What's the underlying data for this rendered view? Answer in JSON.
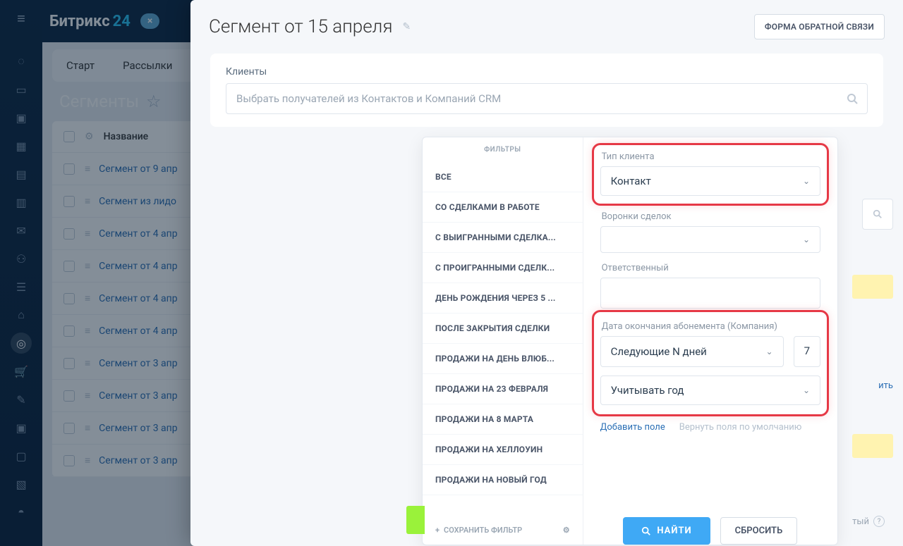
{
  "brand": {
    "part1": "Битрикс",
    "part2": "24",
    "close": "×"
  },
  "bg": {
    "tabs": [
      "Старт",
      "Рассылки"
    ],
    "title": "Сегменты",
    "list_header": "Название",
    "rows": [
      "Сегмент от 9 апр",
      "Сегмент из лидо",
      "Сегмент от 4 апр",
      "Сегмент от 4 апр",
      "Сегмент от 4 апр",
      "Сегмент от 4 апр",
      "Сегмент от 3 апр",
      "Сегмент от 3 апр",
      "Сегмент от 3 апр",
      "Сегмент от 3 апр"
    ]
  },
  "panel": {
    "title": "Сегмент от 15 апреля",
    "feedback_btn": "ФОРМА ОБРАТНОЙ СВЯЗИ",
    "clients_label": "Клиенты",
    "crm_placeholder": "Выбрать получателей из Контактов и Компаний CRM",
    "change": "ить",
    "private": "тый"
  },
  "filters": {
    "header": "ФИЛЬТРЫ",
    "items": [
      "ВСЕ",
      "СО СДЕЛКАМИ В РАБОТЕ",
      "С ВЫИГРАННЫМИ СДЕЛКА...",
      "С ПРОИГРАННЫМИ СДЕЛК...",
      "ДЕНЬ РОЖДЕНИЯ ЧЕРЕЗ 5 ...",
      "ПОСЛЕ ЗАКРЫТИЯ СДЕЛКИ",
      "ПРОДАЖИ НА ДЕНЬ ВЛЮБ...",
      "ПРОДАЖИ НА 23 ФЕВРАЛЯ",
      "ПРОДАЖИ НА 8 МАРТА",
      "ПРОДАЖИ НА ХЕЛЛОУИН",
      "ПРОДАЖИ НА НОВЫЙ ГОД"
    ],
    "save_filter": "СОХРАНИТЬ ФИЛЬТР"
  },
  "form": {
    "client_type_label": "Тип клиента",
    "client_type_value": "Контакт",
    "funnels_label": "Воронки сделок",
    "responsible_label": "Ответственный",
    "expiry_label": "Дата окончания абонемента (Компания)",
    "expiry_mode": "Следующие N дней",
    "expiry_n": "7",
    "expiry_year": "Учитывать год",
    "add_field": "Добавить поле",
    "reset_fields": "Вернуть поля по умолчанию",
    "find": "НАЙТИ",
    "reset": "СБРОСИТЬ"
  }
}
